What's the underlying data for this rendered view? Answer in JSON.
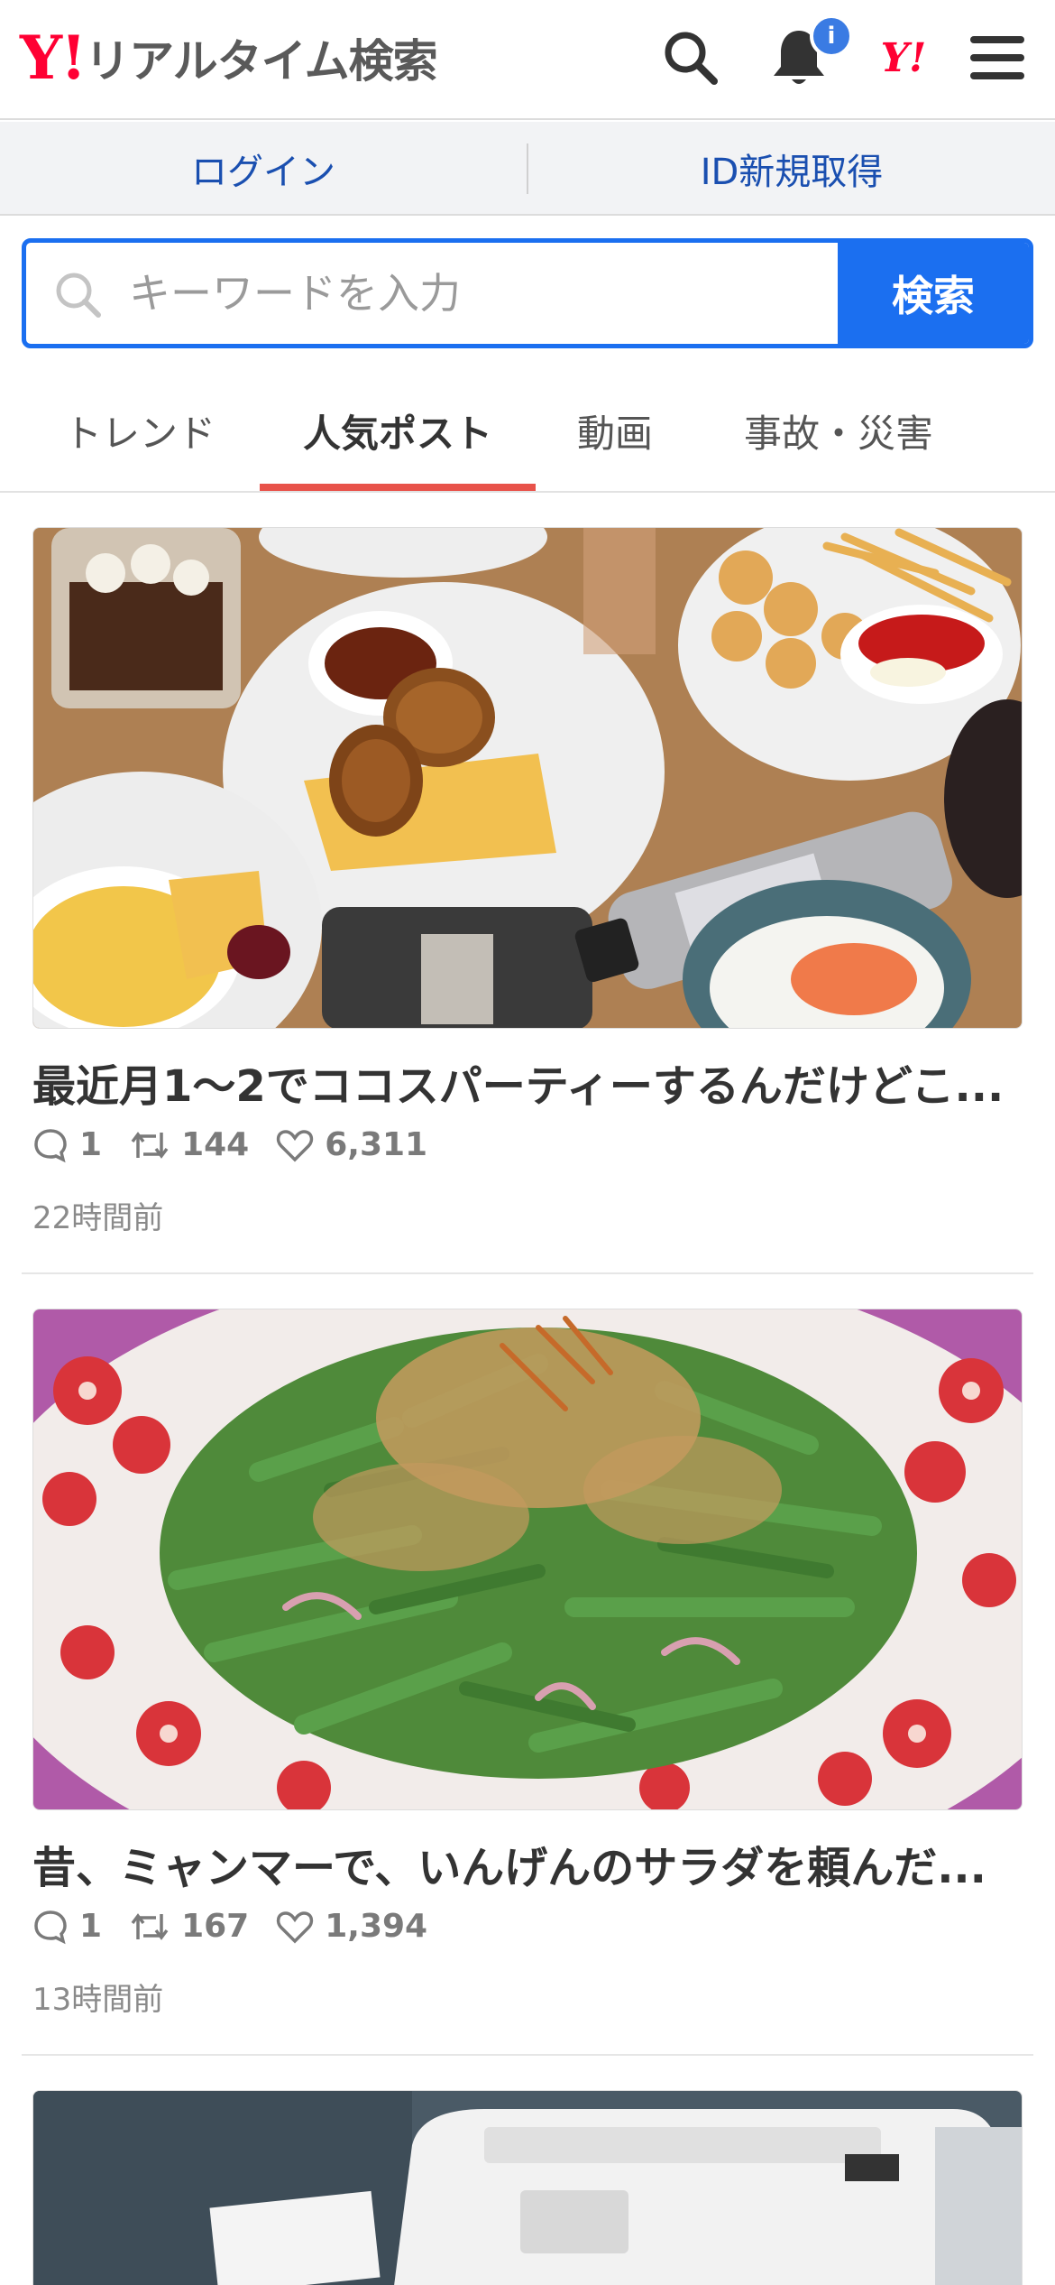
{
  "header": {
    "logo_mark": "Y!",
    "logo_text": "リアルタイム検索",
    "notification_badge": "i",
    "yahoo_icon_text": "Y!"
  },
  "account": {
    "login_label": "ログイン",
    "signup_label": "ID新規取得"
  },
  "search": {
    "placeholder": "キーワードを入力",
    "button_label": "検索"
  },
  "tabs": [
    {
      "label": "トレンド",
      "active": false
    },
    {
      "label": "人気ポスト",
      "active": true
    },
    {
      "label": "動画",
      "active": false
    },
    {
      "label": "事故・災害",
      "active": false
    }
  ],
  "posts": [
    {
      "title": "最近月1〜2でココスパーティーするんだけどこ...",
      "replies": "1",
      "reposts": "144",
      "likes": "6,311",
      "time": "22時間前"
    },
    {
      "title": "昔、ミャンマーで、いんげんのサラダを頼んだ...",
      "replies": "1",
      "reposts": "167",
      "likes": "1,394",
      "time": "13時間前"
    }
  ],
  "colors": {
    "brand_red": "#ff0033",
    "search_blue": "#1b6ff0",
    "tab_indicator": "#e8524a",
    "link_blue": "#1a4fb0"
  }
}
